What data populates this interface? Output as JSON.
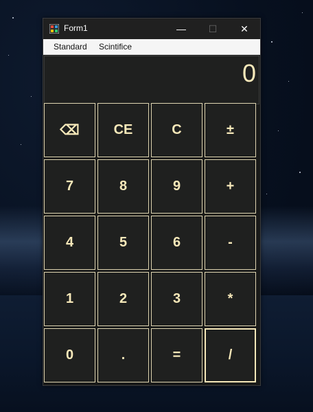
{
  "window": {
    "title": "Form1"
  },
  "controls": {
    "minimize": "—",
    "maximize": "☐",
    "close": "✕"
  },
  "menu": [
    {
      "label": "Standard"
    },
    {
      "label": "Scintifice"
    }
  ],
  "display": {
    "value": "0"
  },
  "keys": [
    [
      {
        "label": "⌫",
        "icon": "backspace-icon"
      },
      {
        "label": "CE"
      },
      {
        "label": "C"
      },
      {
        "label": "±"
      }
    ],
    [
      {
        "label": "7"
      },
      {
        "label": "8"
      },
      {
        "label": "9"
      },
      {
        "label": "+"
      }
    ],
    [
      {
        "label": "4"
      },
      {
        "label": "5"
      },
      {
        "label": "6"
      },
      {
        "label": "-"
      }
    ],
    [
      {
        "label": "1"
      },
      {
        "label": "2"
      },
      {
        "label": "3"
      },
      {
        "label": "*"
      }
    ],
    [
      {
        "label": "0"
      },
      {
        "label": "."
      },
      {
        "label": "="
      },
      {
        "label": "/"
      }
    ]
  ],
  "colors": {
    "accent_text": "#f6e8b9",
    "button_bg": "#1f201f",
    "button_border": "#e0d6b2",
    "window_bg": "#191a19"
  }
}
